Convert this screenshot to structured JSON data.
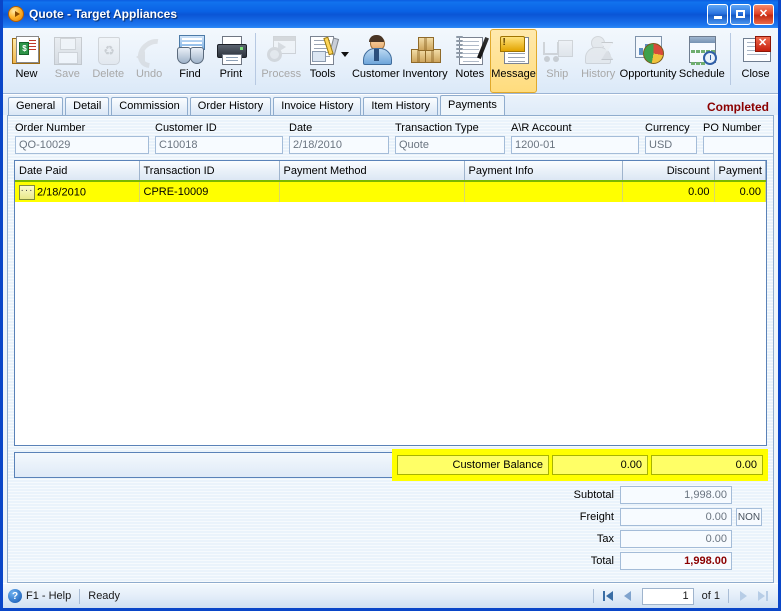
{
  "window": {
    "title": "Quote - Target Appliances",
    "icon": "quote-app-icon",
    "minimize": "Minimize",
    "maximize": "Maximize",
    "close": "Close"
  },
  "toolbar": {
    "items": [
      {
        "label": "New",
        "icon": "new-document-icon",
        "disabled": false
      },
      {
        "label": "Save",
        "icon": "floppy-disk-icon",
        "disabled": true
      },
      {
        "label": "Delete",
        "icon": "recycle-bin-icon",
        "disabled": true
      },
      {
        "label": "Undo",
        "icon": "undo-arrow-icon",
        "disabled": true
      },
      {
        "label": "Find",
        "icon": "binoculars-icon",
        "disabled": false
      },
      {
        "label": "Print",
        "icon": "printer-icon",
        "disabled": false
      },
      {
        "label": "Process",
        "icon": "process-gear-icon",
        "disabled": true
      },
      {
        "label": "Tools",
        "icon": "tools-icon",
        "disabled": false
      },
      {
        "label": "Customer",
        "icon": "customer-person-icon",
        "disabled": false
      },
      {
        "label": "Inventory",
        "icon": "inventory-boxes-icon",
        "disabled": false
      },
      {
        "label": "Notes",
        "icon": "notepad-pen-icon",
        "disabled": false
      },
      {
        "label": "Message",
        "icon": "message-note-icon",
        "disabled": false,
        "active": true
      },
      {
        "label": "Ship",
        "icon": "shipping-cart-icon",
        "disabled": true
      },
      {
        "label": "History",
        "icon": "history-hourglass-icon",
        "disabled": true
      },
      {
        "label": "Opportunity",
        "icon": "pie-chart-icon",
        "disabled": false
      },
      {
        "label": "Schedule",
        "icon": "calendar-clock-icon",
        "disabled": false
      },
      {
        "label": "Close",
        "icon": "close-window-icon",
        "disabled": false
      }
    ]
  },
  "tabs": [
    {
      "label": "General",
      "active": false
    },
    {
      "label": "Detail",
      "active": false
    },
    {
      "label": "Commission",
      "active": false
    },
    {
      "label": "Order History",
      "active": false
    },
    {
      "label": "Invoice History",
      "active": false
    },
    {
      "label": "Item History",
      "active": false
    },
    {
      "label": "Payments",
      "active": true
    }
  ],
  "status_label": "Completed",
  "form": {
    "order_number": {
      "label": "Order Number",
      "value": "QO-10029"
    },
    "customer_id": {
      "label": "Customer ID",
      "value": "C10018"
    },
    "date": {
      "label": "Date",
      "value": "2/18/2010"
    },
    "transaction_type": {
      "label": "Transaction Type",
      "value": "Quote"
    },
    "ar_account": {
      "label": "A\\R Account",
      "value": "1200-01"
    },
    "currency": {
      "label": "Currency",
      "value": "USD"
    },
    "po_number": {
      "label": "PO Number",
      "value": ""
    }
  },
  "grid": {
    "columns": [
      "Date Paid",
      "Transaction ID",
      "Payment Method",
      "Payment Info",
      "Discount",
      "Payment"
    ],
    "rows": [
      {
        "date_paid": "2/18/2010",
        "transaction_id": "CPRE-10009",
        "payment_method": "",
        "payment_info": "",
        "discount": "0.00",
        "payment": "0.00",
        "selected": true,
        "ellipsis": "•••"
      }
    ]
  },
  "balance": {
    "label": "Customer Balance",
    "discount": "0.00",
    "payment": "0.00"
  },
  "totals": {
    "subtotal": {
      "label": "Subtotal",
      "value": "1,998.00"
    },
    "freight": {
      "label": "Freight",
      "value": "0.00",
      "tax_code": "NON"
    },
    "tax": {
      "label": "Tax",
      "value": "0.00"
    },
    "total": {
      "label": "Total",
      "value": "1,998.00"
    }
  },
  "statusbar": {
    "help": "F1 - Help",
    "state": "Ready",
    "record": "1",
    "of": "of  1"
  },
  "colors": {
    "accent_blue": "#0a46c8",
    "highlight_yellow": "#ffff00",
    "status_red": "#8b0000",
    "grid_header_underline": "#7ab800"
  }
}
